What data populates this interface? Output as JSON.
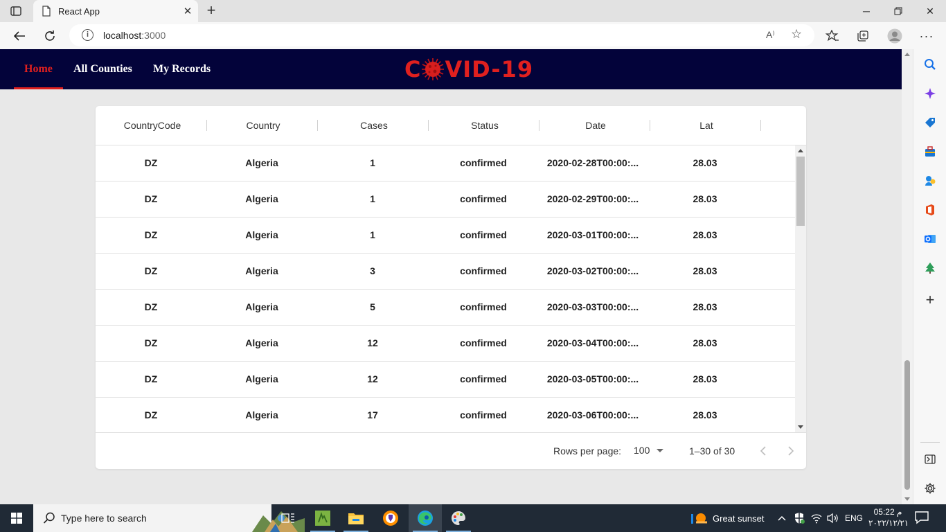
{
  "browser": {
    "tab_title": "React App",
    "url_host": "localhost",
    "url_port": ":3000",
    "read_aloud": "A⁾"
  },
  "navbar": {
    "links": [
      "Home",
      "All Counties",
      "My Records"
    ],
    "active": "Home",
    "logo_text_left": "C",
    "logo_text_right": "VID-19",
    "logo_color": "#e0201f",
    "bg_color": "#03033a"
  },
  "table": {
    "columns": [
      "CountryCode",
      "Country",
      "Cases",
      "Status",
      "Date",
      "Lat"
    ],
    "rows": [
      [
        "DZ",
        "Algeria",
        "1",
        "confirmed",
        "2020-02-28T00:00:...",
        "28.03"
      ],
      [
        "DZ",
        "Algeria",
        "1",
        "confirmed",
        "2020-02-29T00:00:...",
        "28.03"
      ],
      [
        "DZ",
        "Algeria",
        "1",
        "confirmed",
        "2020-03-01T00:00:...",
        "28.03"
      ],
      [
        "DZ",
        "Algeria",
        "3",
        "confirmed",
        "2020-03-02T00:00:...",
        "28.03"
      ],
      [
        "DZ",
        "Algeria",
        "5",
        "confirmed",
        "2020-03-03T00:00:...",
        "28.03"
      ],
      [
        "DZ",
        "Algeria",
        "12",
        "confirmed",
        "2020-03-04T00:00:...",
        "28.03"
      ],
      [
        "DZ",
        "Algeria",
        "12",
        "confirmed",
        "2020-03-05T00:00:...",
        "28.03"
      ],
      [
        "DZ",
        "Algeria",
        "17",
        "confirmed",
        "2020-03-06T00:00:...",
        "28.03"
      ]
    ],
    "footer": {
      "rows_per_page_label": "Rows per page:",
      "rows_per_page_value": "100",
      "range_text": "1–30 of 30"
    }
  },
  "taskbar": {
    "search_placeholder": "Type here to search",
    "weather": "Great sunset",
    "language": "ENG",
    "time": "05:22 م",
    "date": "٢٠٢٢/١٢/٢١",
    "apps": [
      "task-view-icon",
      "app-green-icon",
      "file-explorer-icon",
      "brave-icon",
      "edge-icon",
      "paint-icon"
    ]
  }
}
